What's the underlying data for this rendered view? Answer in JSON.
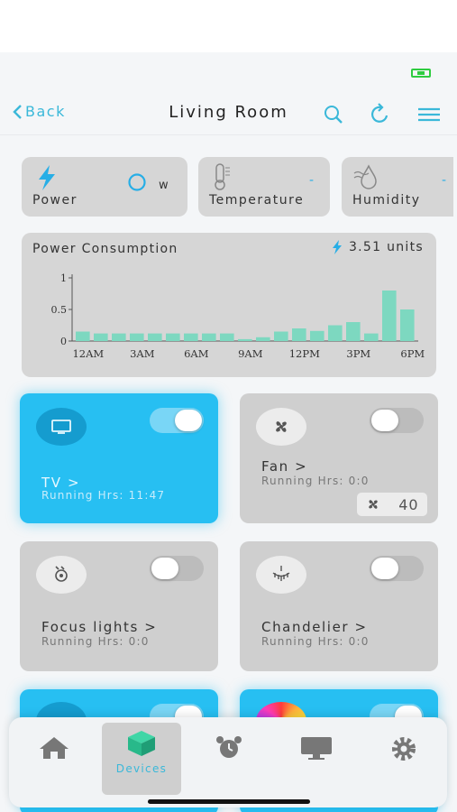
{
  "header": {
    "back_label": "Back",
    "title": "Living Room"
  },
  "stats": {
    "power": {
      "label": "Power",
      "value": "0",
      "unit": "w"
    },
    "temperature": {
      "label": "Temperature",
      "value": "-"
    },
    "humidity": {
      "label": "Humidity",
      "value": "-"
    }
  },
  "chart_data": {
    "type": "bar",
    "title": "Power Consumption",
    "summary": "3.51 units",
    "x_ticks": [
      "12AM",
      "3AM",
      "6AM",
      "9AM",
      "12PM",
      "3PM",
      "6PM"
    ],
    "y_ticks": [
      "0",
      "0.5",
      "1"
    ],
    "ylim": [
      0,
      1
    ],
    "values": [
      0.15,
      0.12,
      0.12,
      0.12,
      0.12,
      0.12,
      0.12,
      0.12,
      0.12,
      0.03,
      0.06,
      0.15,
      0.2,
      0.16,
      0.25,
      0.3,
      0.12,
      0.8,
      0.5
    ],
    "color": "#7dd8c0",
    "grid": false
  },
  "devices": [
    {
      "name": "TV >",
      "running": "Running Hrs: 11:47",
      "on": true,
      "icon": "tv-icon"
    },
    {
      "name": "Fan >",
      "running": "Running Hrs: 0:0",
      "on": false,
      "icon": "fan-icon",
      "speed": "40"
    },
    {
      "name": "Focus lights >",
      "running": "Running Hrs: 0:0",
      "on": false,
      "icon": "bulb-icon"
    },
    {
      "name": "Chandelier >",
      "running": "Running Hrs: 0:0",
      "on": false,
      "icon": "chandelier-icon"
    }
  ],
  "tabs": [
    {
      "label": "",
      "icon": "home-icon"
    },
    {
      "label": "Devices",
      "icon": "cube-icon",
      "active": true
    },
    {
      "label": "",
      "icon": "alarm-clock-icon"
    },
    {
      "label": "",
      "icon": "monitor-icon"
    },
    {
      "label": "",
      "icon": "gear-icon"
    }
  ],
  "colors": {
    "accent": "#3ab8d9",
    "device_on": "#27bff2",
    "card_off": "#cfcfcf",
    "bar": "#7dd8c0"
  }
}
